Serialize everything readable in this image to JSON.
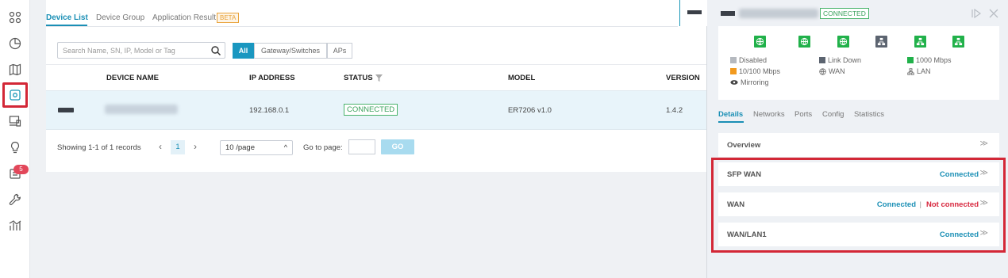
{
  "tabs": {
    "device_list": "Device List",
    "device_group": "Device Group",
    "application_result": "Application Result",
    "beta": "BETA"
  },
  "search": {
    "placeholder": "Search Name, SN, IP, Model or Tag"
  },
  "filters": {
    "all": "All",
    "gateway_switches": "Gateway/Switches",
    "aps": "APs"
  },
  "table": {
    "headers": {
      "device_name": "DEVICE NAME",
      "ip_address": "IP ADDRESS",
      "status": "STATUS",
      "model": "MODEL",
      "version": "VERSION"
    },
    "rows": [
      {
        "ip": "192.168.0.1",
        "status": "CONNECTED",
        "model": "ER7206 v1.0",
        "version": "1.4.2"
      }
    ]
  },
  "pager": {
    "summary": "Showing 1-1 of 1 records",
    "page": "1",
    "prev": "‹",
    "next": "›",
    "per_page": "10 /page",
    "goto_label": "Go to page:",
    "go": "GO"
  },
  "rail": {
    "badge": "5"
  },
  "panel": {
    "status": "CONNECTED",
    "legend": {
      "disabled": "Disabled",
      "link_down": "Link Down",
      "speed_1000": "1000 Mbps",
      "speed_10_100": "10/100 Mbps",
      "wan": "WAN",
      "lan": "LAN",
      "mirroring": "Mirroring"
    },
    "tabs": {
      "details": "Details",
      "networks": "Networks",
      "ports": "Ports",
      "config": "Config",
      "statistics": "Statistics"
    },
    "sections": {
      "overview": "Overview",
      "sfp_wan": {
        "title": "SFP WAN",
        "status": "Connected"
      },
      "wan": {
        "title": "WAN",
        "status": "Connected",
        "separator": "|",
        "status2": "Not connected"
      },
      "wan_lan1": {
        "title": "WAN/LAN1",
        "status": "Connected"
      }
    }
  },
  "colors": {
    "accent": "#1a8fb5",
    "green": "#21b14a",
    "highlight": "#d32736",
    "error": "#d7263d"
  }
}
